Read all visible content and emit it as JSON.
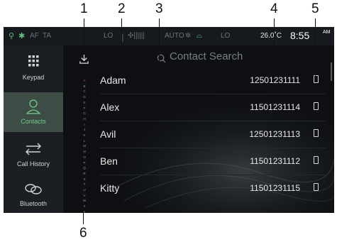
{
  "callouts": [
    "1",
    "2",
    "3",
    "4",
    "5",
    "6"
  ],
  "status": {
    "af": "AF",
    "ta": "TA",
    "lo_left": "LO",
    "auto": "AUTO",
    "lo_right": "LO",
    "temp": "26.0˚C",
    "time": "8:55",
    "ampm": "AM"
  },
  "sidebar": {
    "items": [
      {
        "label": "Keypad"
      },
      {
        "label": "Contacts"
      },
      {
        "label": "Call History"
      },
      {
        "label": "Bluetooth"
      }
    ]
  },
  "search": {
    "placeholder": "Contact Search"
  },
  "alphabet": [
    "A",
    "B",
    "C",
    "D",
    "E",
    "F",
    "G",
    "H",
    "I",
    "J",
    "K",
    "L",
    "M",
    "N",
    "O",
    "P",
    "Q",
    "R",
    "S",
    "T",
    "U",
    "V",
    "W",
    "X",
    "Y",
    "Z"
  ],
  "contacts": [
    {
      "name": "Adam",
      "number": "12501231111"
    },
    {
      "name": "Alex",
      "number": "11501231114"
    },
    {
      "name": "Avil",
      "number": "12501231113"
    },
    {
      "name": "Ben",
      "number": "11501231112"
    },
    {
      "name": "Kitty",
      "number": "11501231115"
    }
  ],
  "colors": {
    "accent": "#6fd08a",
    "screen_bg": "#0d0f12",
    "sidebar_bg": "#1b1e22"
  }
}
